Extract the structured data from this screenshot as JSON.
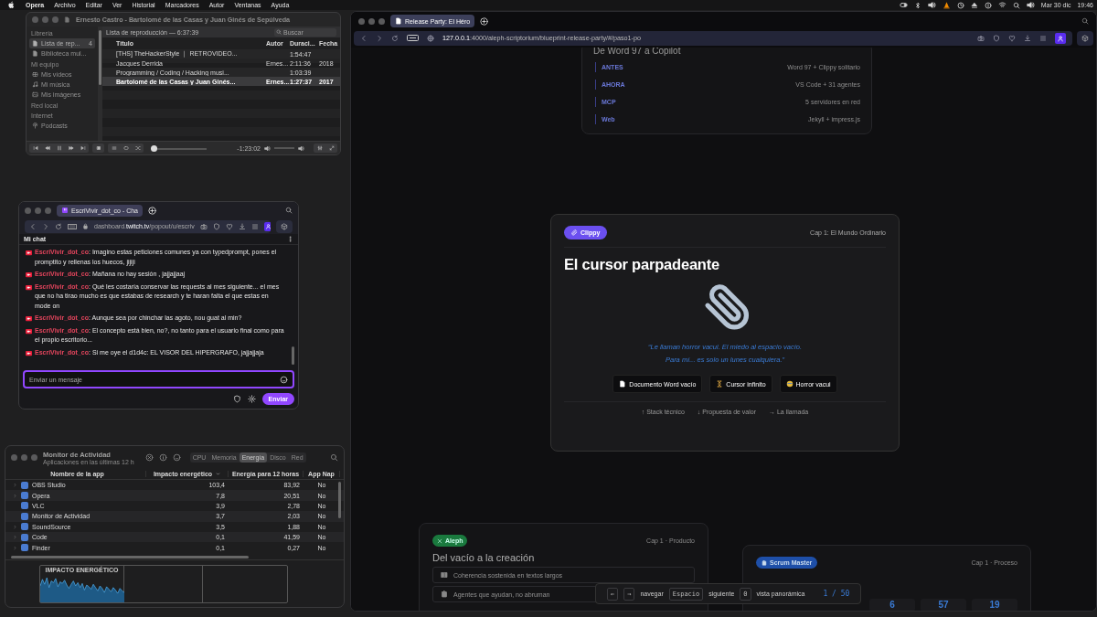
{
  "menu_bar": {
    "app": "Opera",
    "menus": [
      "Archivo",
      "Editar",
      "Ver",
      "Historial",
      "Marcadores",
      "Autor",
      "Ventanas",
      "Ayuda"
    ],
    "date": "Mar 30 dic",
    "time": "19:46"
  },
  "vlc": {
    "title": "Ernesto Castro - Bartolomé de las Casas y Juan Ginés de Sepúlveda",
    "sidebar": [
      {
        "heading": "Librería",
        "items": [
          {
            "label": "Lista de rep...",
            "badge": "4",
            "selected": true
          },
          {
            "label": "Biblioteca mul...",
            "selected": false
          }
        ]
      },
      {
        "heading": "Mi equipo",
        "items": [
          {
            "label": "Mis vídeos",
            "selected": false
          },
          {
            "label": "Mi música",
            "selected": false
          },
          {
            "label": "Mis imágenes",
            "selected": false
          }
        ]
      },
      {
        "heading": "Red local"
      },
      {
        "heading": "Internet",
        "items": [
          {
            "label": "Podcasts",
            "selected": false
          }
        ]
      }
    ],
    "playlist": {
      "title": "Lista de reproducción — 6:37:39",
      "search": {
        "placeholder": "Buscar"
      },
      "columns": [
        "Título",
        "Autor",
        "Duraci...",
        "Fecha"
      ],
      "rows": [
        {
          "title": "[THS] TheHackerStyle ｜ RETROVIDEO...",
          "duration": "1:54:47",
          "selected": false
        },
        {
          "title": "Jacques Derrida",
          "author": "Ernes...",
          "duration": "2:11:36",
          "date": "2018",
          "selected": false
        },
        {
          "title": "Programming / Coding / Hacking musi...",
          "duration": "1:03:39",
          "selected": false
        },
        {
          "title": "Bartolomé de las Casas y Juan Ginés...",
          "author": "Ernes...",
          "duration": "1:27:37",
          "date": "2017",
          "selected": true
        }
      ]
    },
    "player": {
      "progress": {
        "level": 0.03
      },
      "time": "-1:23:02"
    }
  },
  "chat": {
    "tab": "EscriVivir_dot_co - Cha",
    "url": "dashboard.**twitch.tv**/popout/u/escriv",
    "header": "Mi chat",
    "messages": [
      {
        "text": "**EscriVivir_dot_co**: Imagino estas peticiones comunes ya con typedprompt, pones el promptito y rellenas los huecos, jijiji"
      },
      {
        "text": "**EscriVivir_dot_co**: Mañana no hay sesión , jajjajjaaj"
      },
      {
        "text": "**EscriVivir_dot_co**: Qué les costaría conservar las requests al mes siguiente... el mes que no ha tirao mucho es que estabas de research y te haran falta el que estas en mode on"
      },
      {
        "text": "**EscriVivir_dot_co**: Aunque sea por chinchar las agoto, nou guat al min?"
      },
      {
        "text": "**EscriVivir_dot_co**: El concepto está bien, no?, no tanto para el usuario final como para el propio escritorio..."
      },
      {
        "text": "**EscriVivir_dot_co**: Si me oye el d1d4c: EL VISOR DEL HIPERGRAFO, jajjajjaja"
      }
    ],
    "input": {
      "placeholder": "Enviar un mensaje"
    },
    "send_button": "Enviar"
  },
  "activity_monitor": {
    "title": "Monitor de Actividad",
    "subtitle": "Aplicaciones en las últimas 12 h",
    "tabs": [
      {
        "label": "CPU",
        "selected": false
      },
      {
        "label": "Memoria",
        "selected": false
      },
      {
        "label": "Energía",
        "selected": true
      },
      {
        "label": "Disco",
        "selected": false
      },
      {
        "label": "Red",
        "selected": false
      }
    ],
    "columns": [
      "Nombre de la app",
      "Impacto energético",
      "Energía para 12 horas",
      "App Nap"
    ],
    "rows": [
      {
        "name": "OBS Studio",
        "expandable": true,
        "impact": "103,4",
        "energy": "83,92",
        "app_nap": "No"
      },
      {
        "name": "Opera",
        "expandable": true,
        "impact": "7,8",
        "energy": "20,51",
        "app_nap": "No"
      },
      {
        "name": "VLC",
        "expandable": false,
        "impact": "3,9",
        "energy": "2,78",
        "app_nap": "No"
      },
      {
        "name": "Monitor de Actividad",
        "expandable": false,
        "impact": "3,7",
        "energy": "2,03",
        "app_nap": "No"
      },
      {
        "name": "SoundSource",
        "expandable": true,
        "impact": "3,5",
        "energy": "1,88",
        "app_nap": "No"
      },
      {
        "name": "Code",
        "expandable": true,
        "impact": "0,1",
        "energy": "41,59",
        "app_nap": "No"
      },
      {
        "name": "Finder",
        "expandable": true,
        "impact": "0,1",
        "energy": "0,27",
        "app_nap": "No"
      }
    ],
    "graph": {
      "title": "IMPACTO ENERGÉTICO"
    }
  },
  "browser": {
    "tab": "Release Party: El Héro",
    "url": "**127.0.0.1**:4000/aleph-scriptorium/blueprint-release-party/#/paso1-po",
    "slides": [
      {
        "kind": "comparison",
        "title": "De Word 97 a Copilot",
        "rows": [
          {
            "label": "ANTES",
            "value": "Word 97 + Clippy solitario"
          },
          {
            "label": "AHORA",
            "value": "VS Code + 31 agentes"
          },
          {
            "label": "MCP",
            "value": "5 servidores en red"
          },
          {
            "label": "Web",
            "value": "Jekyll + impress.js"
          }
        ]
      },
      {
        "kind": "hero",
        "badge": "Clippy",
        "chapter": "Cap 1: El Mundo Ordinario",
        "title": "El cursor parpadeante",
        "quote": [
          "“Le llaman horror vacui. El miedo al espacio vacío.",
          "Para mí... es solo un lunes cualquiera.”"
        ],
        "buttons": [
          "Documento Word vacío",
          "Cursor infinito",
          "Horror vacui"
        ],
        "links": [
          "↑ Stack técnico",
          "↓ Propuesta de valor",
          "→ La llamada"
        ]
      },
      {
        "kind": "features",
        "badge": "Aleph",
        "chapter": "Cap 1 · Producto",
        "title": "Del vacío a la creación",
        "items": [
          "Coherencia sostenida en textos largos",
          "Agentes que ayudan, no abruman"
        ]
      },
      {
        "kind": "stats",
        "badge": "Scrum Master",
        "chapter": "Cap 1 · Proceso",
        "stats": [
          "6",
          "57",
          "19"
        ]
      }
    ],
    "nav": {
      "items": [
        {
          "kind": "key",
          "text": "←"
        },
        {
          "kind": "key",
          "text": "→"
        },
        {
          "kind": "label",
          "text": "navegar"
        },
        {
          "kind": "key",
          "text": "Espacio"
        },
        {
          "kind": "label",
          "text": "siguiente"
        },
        {
          "kind": "key",
          "text": "0"
        },
        {
          "kind": "label",
          "text": "vista panorámica"
        }
      ],
      "counter": "1 / 50"
    }
  }
}
